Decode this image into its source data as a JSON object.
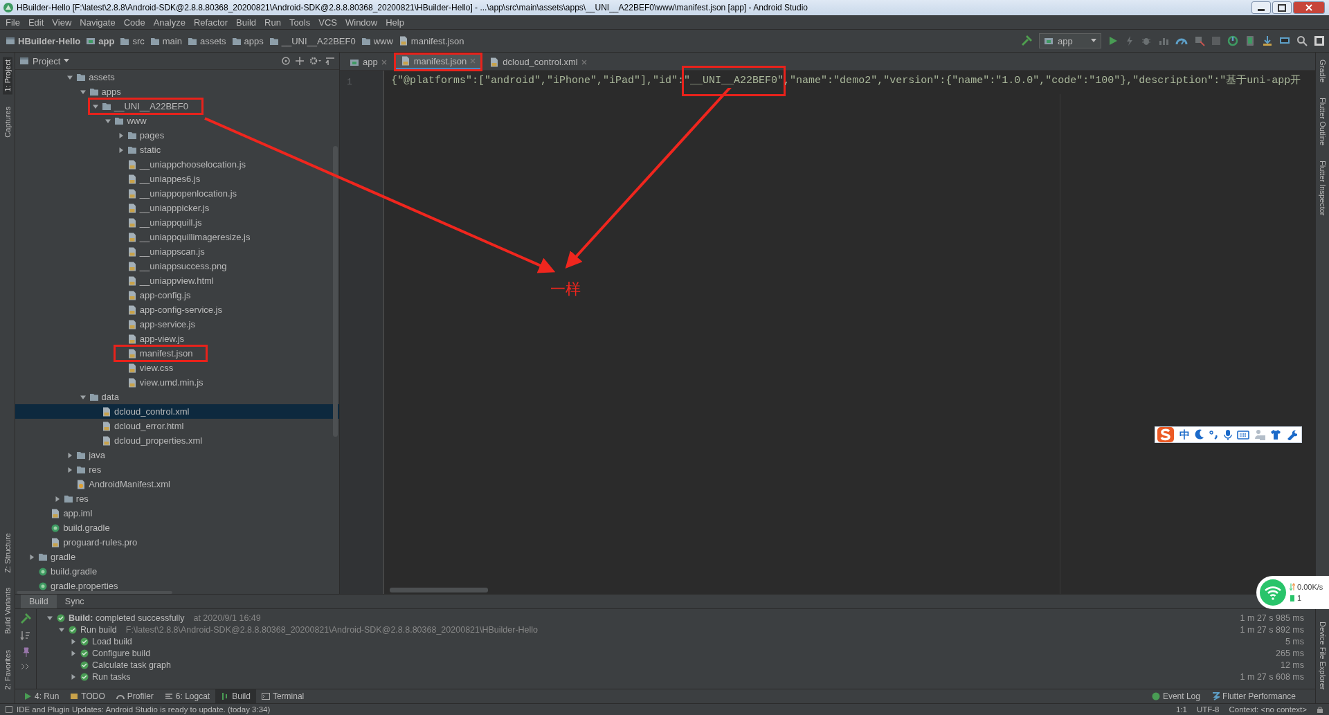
{
  "window": {
    "title": "HBuilder-Hello [F:\\latest\\2.8.8\\Android-SDK@2.8.8.80368_20200821\\Android-SDK@2.8.8.80368_20200821\\HBuilder-Hello] - ...\\app\\src\\main\\assets\\apps\\__UNI__A22BEF0\\www\\manifest.json [app] - Android Studio"
  },
  "menu": [
    "File",
    "Edit",
    "View",
    "Navigate",
    "Code",
    "Analyze",
    "Refactor",
    "Build",
    "Run",
    "Tools",
    "VCS",
    "Window",
    "Help"
  ],
  "breadcrumb": [
    {
      "label": "HBuilder-Hello",
      "kind": "project"
    },
    {
      "label": "app",
      "kind": "module"
    },
    {
      "label": "src",
      "kind": "folder"
    },
    {
      "label": "main",
      "kind": "folder"
    },
    {
      "label": "assets",
      "kind": "folder"
    },
    {
      "label": "apps",
      "kind": "folder"
    },
    {
      "label": "__UNI__A22BEF0",
      "kind": "folder"
    },
    {
      "label": "www",
      "kind": "folder"
    },
    {
      "label": "manifest.json",
      "kind": "file"
    }
  ],
  "run_config": {
    "label": "app"
  },
  "left_strip": {
    "top": [
      {
        "label": "1: Project",
        "selected": true
      },
      {
        "label": "Captures",
        "selected": false
      }
    ],
    "bottom": [
      {
        "label": "Z: Structure",
        "selected": false
      },
      {
        "label": "Build Variants",
        "selected": false
      },
      {
        "label": "2: Favorites",
        "selected": false
      }
    ]
  },
  "right_strip": {
    "top": [
      {
        "label": "Gradle"
      },
      {
        "label": "Flutter Outline"
      },
      {
        "label": "Flutter Inspector"
      }
    ],
    "bottom": [
      {
        "label": "Device File Explorer"
      }
    ]
  },
  "project": {
    "title": "Project",
    "tree": [
      {
        "children": [
          {
            "children": [
              {
                "children": [
                  {
                    "label": "assets",
                    "kind": "folder",
                    "expanded": true,
                    "selected": false,
                    "highlighted": false,
                    "children": [
                      {
                        "label": "apps",
                        "kind": "folder",
                        "expanded": true,
                        "selected": false,
                        "highlighted": false,
                        "children": [
                          {
                            "label": "__UNI__A22BEF0",
                            "kind": "folder",
                            "expanded": true,
                            "selected": false,
                            "highlighted": true,
                            "children": [
                              {
                                "label": "www",
                                "kind": "folder",
                                "expanded": true,
                                "selected": false,
                                "highlighted": false,
                                "children": [
                                  {
                                    "label": "pages",
                                    "kind": "folder",
                                    "expanded": false,
                                    "selected": false,
                                    "highlighted": false
                                  },
                                  {
                                    "label": "static",
                                    "kind": "folder",
                                    "expanded": false,
                                    "selected": false,
                                    "highlighted": false
                                  },
                                  {
                                    "label": "__uniappchooselocation.js",
                                    "kind": "file",
                                    "selected": false,
                                    "highlighted": false
                                  },
                                  {
                                    "label": "__uniappes6.js",
                                    "kind": "file",
                                    "selected": false,
                                    "highlighted": false
                                  },
                                  {
                                    "label": "__uniappopenlocation.js",
                                    "kind": "file",
                                    "selected": false,
                                    "highlighted": false
                                  },
                                  {
                                    "label": "__uniapppicker.js",
                                    "kind": "file",
                                    "selected": false,
                                    "highlighted": false
                                  },
                                  {
                                    "label": "__uniappquill.js",
                                    "kind": "file",
                                    "selected": false,
                                    "highlighted": false
                                  },
                                  {
                                    "label": "__uniappquillimageresize.js",
                                    "kind": "file",
                                    "selected": false,
                                    "highlighted": false
                                  },
                                  {
                                    "label": "__uniappscan.js",
                                    "kind": "file",
                                    "selected": false,
                                    "highlighted": false
                                  },
                                  {
                                    "label": "__uniappsuccess.png",
                                    "kind": "file",
                                    "selected": false,
                                    "highlighted": false
                                  },
                                  {
                                    "label": "__uniappview.html",
                                    "kind": "file",
                                    "selected": false,
                                    "highlighted": false
                                  },
                                  {
                                    "label": "app-config.js",
                                    "kind": "file",
                                    "selected": false,
                                    "highlighted": false
                                  },
                                  {
                                    "label": "app-config-service.js",
                                    "kind": "file",
                                    "selected": false,
                                    "highlighted": false
                                  },
                                  {
                                    "label": "app-service.js",
                                    "kind": "file",
                                    "selected": false,
                                    "highlighted": false
                                  },
                                  {
                                    "label": "app-view.js",
                                    "kind": "file",
                                    "selected": false,
                                    "highlighted": false
                                  },
                                  {
                                    "label": "manifest.json",
                                    "kind": "file",
                                    "selected": false,
                                    "highlighted": true
                                  },
                                  {
                                    "label": "view.css",
                                    "kind": "file",
                                    "selected": false,
                                    "highlighted": false
                                  },
                                  {
                                    "label": "view.umd.min.js",
                                    "kind": "file",
                                    "selected": false,
                                    "highlighted": false
                                  }
                                ]
                              }
                            ]
                          }
                        ]
                      },
                      {
                        "label": "data",
                        "kind": "folder",
                        "expanded": true,
                        "selected": false,
                        "highlighted": false,
                        "children": [
                          {
                            "label": "dcloud_control.xml",
                            "kind": "file",
                            "selected": true,
                            "highlighted": false
                          },
                          {
                            "label": "dcloud_error.html",
                            "kind": "file",
                            "selected": false,
                            "highlighted": false
                          },
                          {
                            "label": "dcloud_properties.xml",
                            "kind": "file",
                            "selected": false,
                            "highlighted": false
                          }
                        ]
                      }
                    ]
                  },
                  {
                    "label": "java",
                    "kind": "folder",
                    "expanded": false,
                    "selected": false,
                    "highlighted": false
                  },
                  {
                    "label": "res",
                    "kind": "folder",
                    "expanded": false,
                    "selected": false,
                    "highlighted": false
                  },
                  {
                    "label": "AndroidManifest.xml",
                    "kind": "manifest",
                    "selected": false,
                    "highlighted": false
                  }
                ]
              },
              {
                "label": "res",
                "kind": "folder",
                "expanded": false,
                "selected": false,
                "highlighted": false
              }
            ]
          },
          {
            "label": "app.iml",
            "kind": "file",
            "selected": false,
            "highlighted": false
          },
          {
            "label": "build.gradle",
            "kind": "gradle",
            "selected": false,
            "highlighted": false
          },
          {
            "label": "proguard-rules.pro",
            "kind": "file",
            "selected": false,
            "highlighted": false
          }
        ]
      },
      {
        "label": "gradle",
        "kind": "folder",
        "expanded": false,
        "selected": false,
        "highlighted": false
      },
      {
        "label": "build.gradle",
        "kind": "gradle",
        "selected": false,
        "highlighted": false
      },
      {
        "label": "gradle.properties",
        "kind": "gradle",
        "selected": false,
        "highlighted": false
      }
    ]
  },
  "editor": {
    "tabs": [
      {
        "label": "app",
        "kind": "module",
        "selected": false,
        "highlighted": false
      },
      {
        "label": "manifest.json",
        "kind": "file",
        "selected": true,
        "highlighted": true
      },
      {
        "label": "dcloud_control.xml",
        "kind": "file",
        "selected": false,
        "highlighted": false
      }
    ],
    "line_numbers": [
      "1"
    ],
    "code": [
      {
        "text": "{\"@platforms\":[\"android\",\"iPhone\",\"iPad\"],\"id\":",
        "highlighted": false
      },
      {
        "text": "\"__UNI__A22BEF0\"",
        "highlighted": true
      },
      {
        "text": ",\"name\":\"demo2\",\"version\":{\"name\":\"1.0.0\",\"code\":\"100\"},\"description\":\"基于uni-app开",
        "highlighted": false
      }
    ]
  },
  "annotation": {
    "label": "一样"
  },
  "build": {
    "tabs": [
      {
        "label": "Build",
        "selected": true
      },
      {
        "label": "Sync",
        "selected": false
      }
    ],
    "tree": [
      {
        "label": "**Build:** completed successfully",
        "detail": "at 2020/9/1 16:49",
        "time": "1 m 27 s 985 ms",
        "expanded": true,
        "children": [
          {
            "label": "Run build",
            "detail": "F:\\latest\\2.8.8\\Android-SDK@2.8.8.80368_20200821\\Android-SDK@2.8.8.80368_20200821\\HBuilder-Hello",
            "time": "1 m 27 s 892 ms",
            "expanded": true,
            "children": [
              {
                "label": "Load build",
                "time": "5 ms",
                "expanded": false
              },
              {
                "label": "Configure build",
                "time": "265 ms",
                "expanded": false
              },
              {
                "label": "Calculate task graph",
                "time": "12 ms"
              },
              {
                "label": "Run tasks",
                "time": "1 m 27 s 608 ms",
                "expanded": false
              }
            ]
          }
        ]
      }
    ]
  },
  "tool_windows": {
    "left": [
      {
        "label": "4: Run",
        "selected": false
      },
      {
        "label": "TODO",
        "selected": false
      },
      {
        "label": "Profiler",
        "selected": false
      },
      {
        "label": "6: Logcat",
        "selected": false
      },
      {
        "label": "Build",
        "selected": true
      },
      {
        "label": "Terminal",
        "selected": false
      }
    ],
    "right": [
      {
        "label": "Event Log",
        "selected": false
      },
      {
        "label": "Flutter Performance",
        "selected": false
      }
    ]
  },
  "status_bar": {
    "message": "IDE and Plugin Updates: Android Studio is ready to update. (today 3:34)",
    "position": "1:1",
    "encoding": "UTF-8",
    "context": "Context: <no context>"
  },
  "ime_toolbar": {
    "mode": "中"
  },
  "network_widget": {
    "speed": "0.00K/s",
    "count": "1"
  }
}
